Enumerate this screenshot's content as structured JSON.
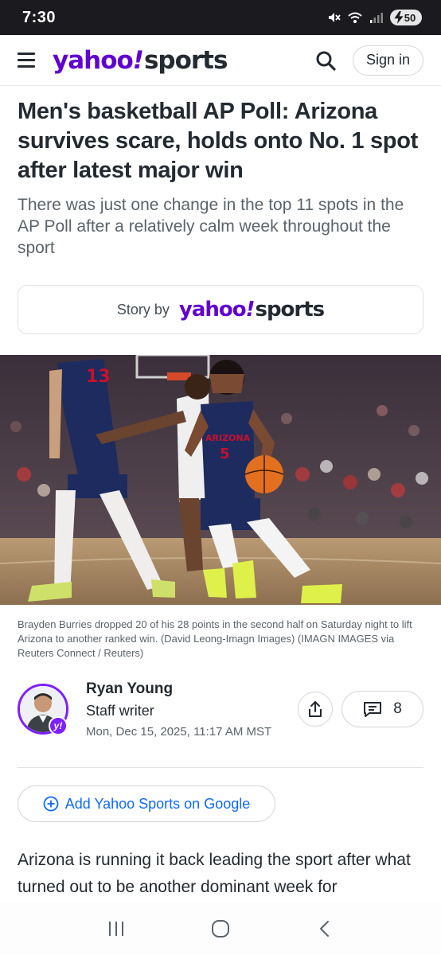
{
  "status_bar": {
    "time": "7:30",
    "battery": "50"
  },
  "header": {
    "logo_part1": "yahoo",
    "logo_part2": "!",
    "logo_part3": "sports",
    "signin_label": "Sign in"
  },
  "article": {
    "headline": "Men's basketball AP Poll: Arizona survives scare, holds onto No. 1 spot after latest major win",
    "subheadline": "There was just one change in the top 11 spots in the AP Poll after a relatively calm week throughout the sport",
    "story_by_label": "Story by",
    "image_caption": "Brayden Burries dropped 20 of his 28 points in the second half on Saturday night to lift Arizona to another ranked win. (David Leong-Imagn Images) (IMAGN IMAGES via Reuters Connect / Reuters)",
    "jersey_13": "13",
    "jersey_5": "5",
    "jersey_team": "ARIZONA",
    "author_name": "Ryan Young",
    "author_role": "Staff writer",
    "published": "Mon, Dec 15, 2025, 11:17 AM MST",
    "comments_count": "8",
    "google_button": "Add Yahoo Sports on Google",
    "body_start": "Arizona is running it back leading the sport after what turned out to be another dominant week for"
  },
  "colors": {
    "brand_purple": "#6001d2",
    "link_blue": "#0f69ff",
    "avatar_ring": "#7e1fff"
  },
  "icons": [
    "menu-icon",
    "search-icon",
    "share-icon",
    "comment-icon",
    "plus-circle-icon",
    "recents-icon",
    "home-icon",
    "back-icon",
    "mute-icon",
    "wifi-icon",
    "signal-icon"
  ]
}
